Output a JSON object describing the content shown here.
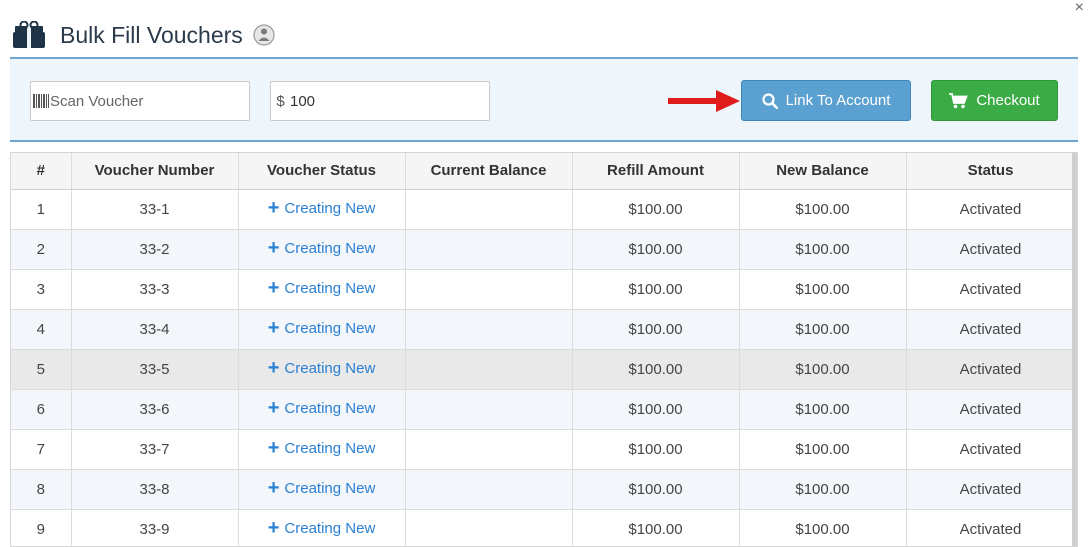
{
  "dialog": {
    "title": "Bulk Fill Vouchers",
    "close_label": "×"
  },
  "toolbar": {
    "scan_placeholder": "Scan Voucher",
    "amount_prefix": "$",
    "amount_value": "100",
    "link_label": "Link To Account",
    "checkout_label": "Checkout"
  },
  "colors": {
    "link_button": "#5aa0d0",
    "checkout_button": "#3bab45",
    "accent_border": "#6fa6cf",
    "status_link": "#2a7fd4",
    "annotation_arrow": "#e01b1b"
  },
  "icons": {
    "title": "gift-icon",
    "help": "help-icon",
    "scan": "barcode-icon",
    "link": "search-icon",
    "checkout": "cart-icon"
  },
  "table": {
    "columns": [
      "#",
      "Voucher Number",
      "Voucher Status",
      "Current Balance",
      "Refill Amount",
      "New Balance",
      "Status"
    ],
    "rows": [
      {
        "num": "1",
        "voucher": "33-1",
        "voucher_status": "Creating New",
        "current": "",
        "refill": "$100.00",
        "new_balance": "$100.00",
        "status": "Activated"
      },
      {
        "num": "2",
        "voucher": "33-2",
        "voucher_status": "Creating New",
        "current": "",
        "refill": "$100.00",
        "new_balance": "$100.00",
        "status": "Activated"
      },
      {
        "num": "3",
        "voucher": "33-3",
        "voucher_status": "Creating New",
        "current": "",
        "refill": "$100.00",
        "new_balance": "$100.00",
        "status": "Activated"
      },
      {
        "num": "4",
        "voucher": "33-4",
        "voucher_status": "Creating New",
        "current": "",
        "refill": "$100.00",
        "new_balance": "$100.00",
        "status": "Activated"
      },
      {
        "num": "5",
        "voucher": "33-5",
        "voucher_status": "Creating New",
        "current": "",
        "refill": "$100.00",
        "new_balance": "$100.00",
        "status": "Activated"
      },
      {
        "num": "6",
        "voucher": "33-6",
        "voucher_status": "Creating New",
        "current": "",
        "refill": "$100.00",
        "new_balance": "$100.00",
        "status": "Activated"
      },
      {
        "num": "7",
        "voucher": "33-7",
        "voucher_status": "Creating New",
        "current": "",
        "refill": "$100.00",
        "new_balance": "$100.00",
        "status": "Activated"
      },
      {
        "num": "8",
        "voucher": "33-8",
        "voucher_status": "Creating New",
        "current": "",
        "refill": "$100.00",
        "new_balance": "$100.00",
        "status": "Activated"
      },
      {
        "num": "9",
        "voucher": "33-9",
        "voucher_status": "Creating New",
        "current": "",
        "refill": "$100.00",
        "new_balance": "$100.00",
        "status": "Activated"
      }
    ]
  }
}
